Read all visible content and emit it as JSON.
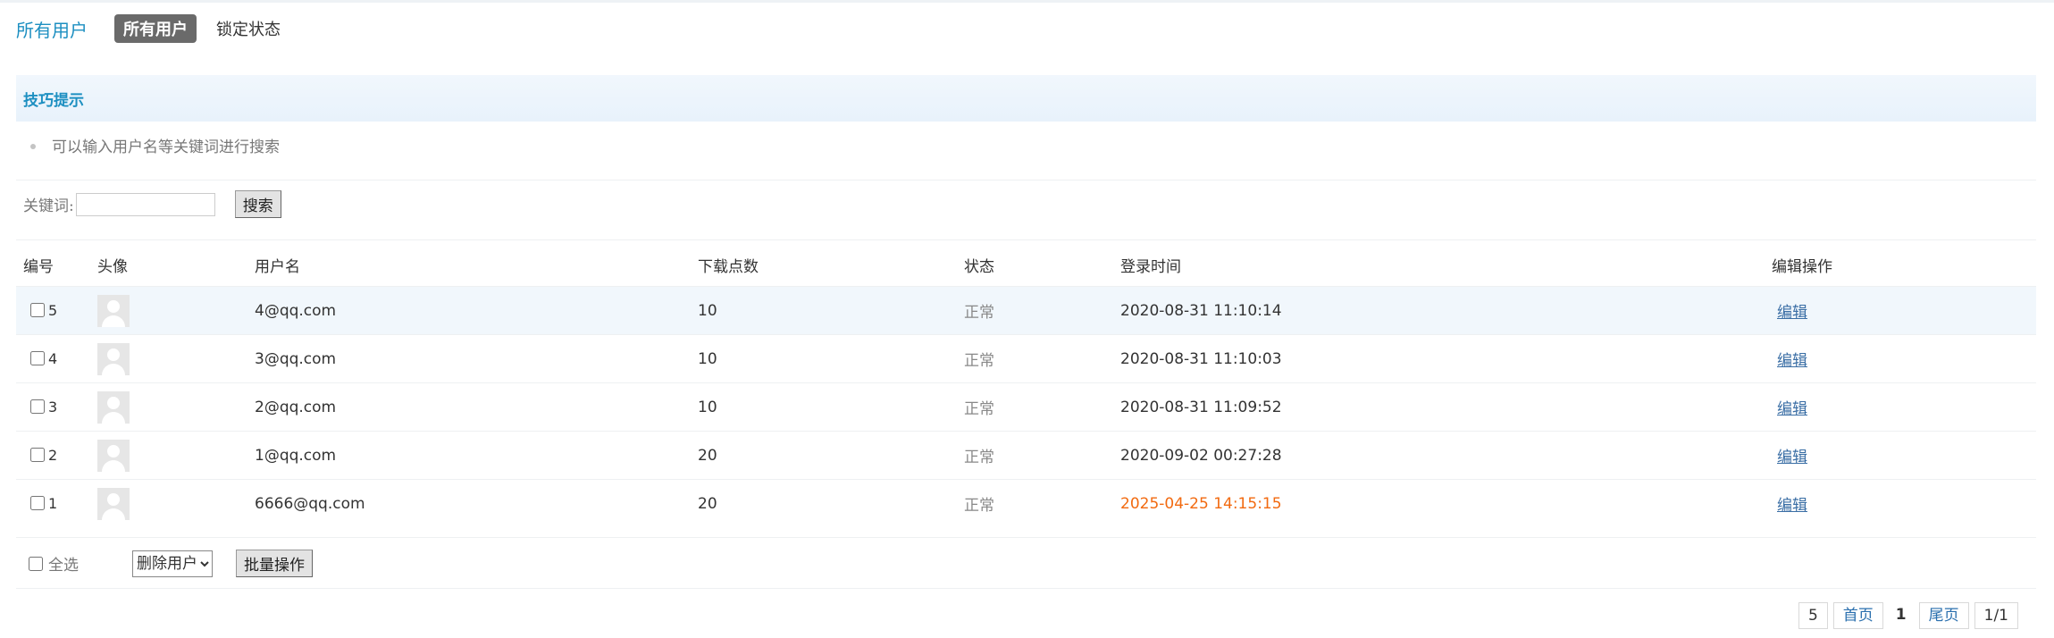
{
  "tabs": {
    "title": "所有用户",
    "active": "所有用户",
    "locked": "锁定状态"
  },
  "tip": {
    "header": "技巧提示",
    "item": "可以输入用户名等关键词进行搜索"
  },
  "search": {
    "label": "关键词:",
    "value": "",
    "button": "搜索"
  },
  "table": {
    "headers": [
      "编号",
      "头像",
      "用户名",
      "下载点数",
      "状态",
      "登录时间",
      "编辑操作"
    ],
    "rows": [
      {
        "id": "5",
        "username": "4@qq.com",
        "points": "10",
        "status": "正常",
        "login": "2020-08-31 11:10:14",
        "edit": "编辑"
      },
      {
        "id": "4",
        "username": "3@qq.com",
        "points": "10",
        "status": "正常",
        "login": "2020-08-31 11:10:03",
        "edit": "编辑"
      },
      {
        "id": "3",
        "username": "2@qq.com",
        "points": "10",
        "status": "正常",
        "login": "2020-08-31 11:09:52",
        "edit": "编辑"
      },
      {
        "id": "2",
        "username": "1@qq.com",
        "points": "20",
        "status": "正常",
        "login": "2020-09-02 00:27:28",
        "edit": "编辑"
      },
      {
        "id": "1",
        "username": "6666@qq.com",
        "points": "20",
        "status": "正常",
        "login": "2025-04-25 14:15:15",
        "edit": "编辑"
      }
    ]
  },
  "bulk": {
    "select_all": "全选",
    "action_selected": "删除用户",
    "button": "批量操作"
  },
  "pager": {
    "total": "5",
    "first": "首页",
    "current": "1",
    "last": "尾页",
    "pages": "1/1"
  },
  "colors": {
    "accent": "#1d8fc1",
    "highlight_time": "#f26a10",
    "link": "#3a6ea5"
  }
}
